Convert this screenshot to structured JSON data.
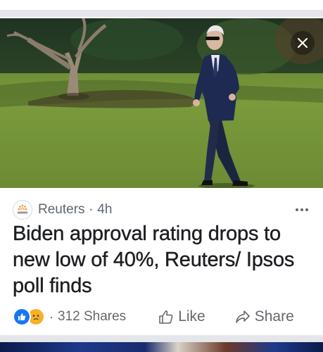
{
  "post": {
    "publisher": "Reuters",
    "time": "4h",
    "headline": "Biden approval rating drops to new low of 40%, Reuters/ Ipsos poll finds",
    "shares": "312 Shares",
    "like_label": "Like",
    "share_label": "Share",
    "separator": "·"
  },
  "icons": {
    "close": "close-icon",
    "more": "more-options-icon",
    "like_reaction": "like-reaction-icon",
    "sad_reaction": "sad-reaction-icon",
    "thumbs_up": "thumbs-up-icon",
    "share": "share-arrow-icon"
  },
  "colors": {
    "facebook_blue": "#1877f2",
    "secondary_text": "#65676b",
    "headline_text": "#1c1e21",
    "divider": "#e4e6eb"
  }
}
